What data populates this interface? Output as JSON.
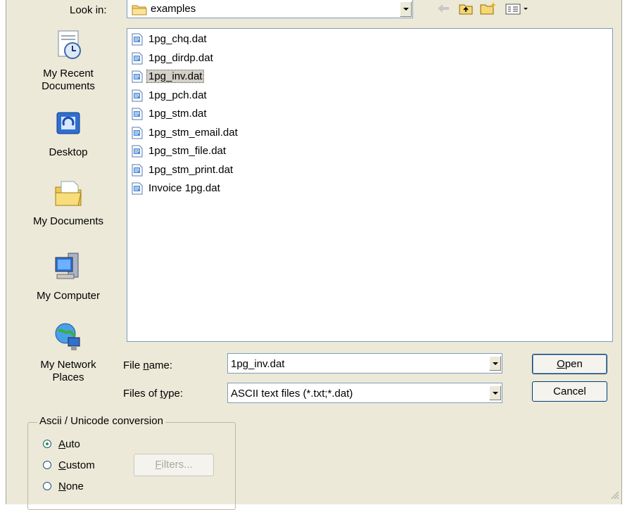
{
  "lookin": {
    "label": "Look in:",
    "value": "examples"
  },
  "toolbar": {
    "icons": [
      "back-icon",
      "up-folder-icon",
      "new-folder-icon",
      "view-menu-icon"
    ]
  },
  "places": [
    {
      "label_line1": "My Recent",
      "label_line2": "Documents",
      "icon": "recent-documents-icon"
    },
    {
      "label_line1": "Desktop",
      "label_line2": "",
      "icon": "desktop-icon"
    },
    {
      "label_line1": "My Documents",
      "label_line2": "",
      "icon": "my-documents-icon"
    },
    {
      "label_line1": "My Computer",
      "label_line2": "",
      "icon": "my-computer-icon"
    },
    {
      "label_line1": "My Network",
      "label_line2": "Places",
      "icon": "network-places-icon"
    }
  ],
  "files": [
    {
      "name": "1pg_chq.dat",
      "selected": false
    },
    {
      "name": "1pg_dirdp.dat",
      "selected": false
    },
    {
      "name": "1pg_inv.dat",
      "selected": true
    },
    {
      "name": "1pg_pch.dat",
      "selected": false
    },
    {
      "name": "1pg_stm.dat",
      "selected": false
    },
    {
      "name": "1pg_stm_email.dat",
      "selected": false
    },
    {
      "name": "1pg_stm_file.dat",
      "selected": false
    },
    {
      "name": "1pg_stm_print.dat",
      "selected": false
    },
    {
      "name": "Invoice 1pg.dat",
      "selected": false
    }
  ],
  "filename": {
    "label_pre": "File ",
    "label_u": "n",
    "label_post": "ame:",
    "value": "1pg_inv.dat"
  },
  "filetype": {
    "label_pre": "Files of ",
    "label_u": "t",
    "label_post": "ype:",
    "value": "ASCII text files (*.txt;*.dat)"
  },
  "buttons": {
    "open_u": "O",
    "open_rest": "pen",
    "cancel": "Cancel"
  },
  "conversion": {
    "title": "Ascii / Unicode conversion",
    "options": [
      {
        "u": "A",
        "rest": "uto",
        "checked": true
      },
      {
        "u": "C",
        "rest": "ustom",
        "checked": false
      },
      {
        "u": "N",
        "rest": "one",
        "checked": false
      }
    ],
    "filters_u": "F",
    "filters_rest": "ilters..."
  },
  "colors": {
    "dialog_bg": "#ece9d8",
    "field_border": "#7f9db9",
    "button_border": "#003c74"
  }
}
